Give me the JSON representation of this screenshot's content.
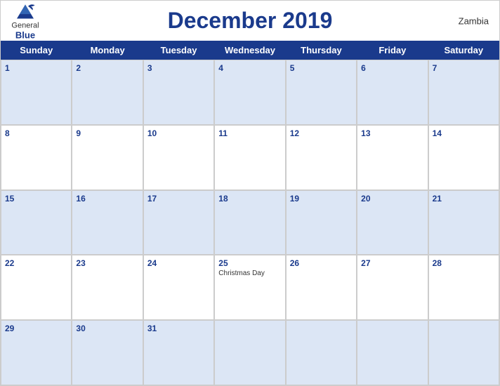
{
  "header": {
    "title": "December 2019",
    "country": "Zambia",
    "logo": {
      "general": "General",
      "blue": "Blue"
    }
  },
  "days": [
    "Sunday",
    "Monday",
    "Tuesday",
    "Wednesday",
    "Thursday",
    "Friday",
    "Saturday"
  ],
  "weeks": [
    [
      {
        "date": "1",
        "blue": true,
        "event": ""
      },
      {
        "date": "2",
        "blue": true,
        "event": ""
      },
      {
        "date": "3",
        "blue": true,
        "event": ""
      },
      {
        "date": "4",
        "blue": true,
        "event": ""
      },
      {
        "date": "5",
        "blue": true,
        "event": ""
      },
      {
        "date": "6",
        "blue": true,
        "event": ""
      },
      {
        "date": "7",
        "blue": true,
        "event": ""
      }
    ],
    [
      {
        "date": "8",
        "blue": false,
        "event": ""
      },
      {
        "date": "9",
        "blue": false,
        "event": ""
      },
      {
        "date": "10",
        "blue": false,
        "event": ""
      },
      {
        "date": "11",
        "blue": false,
        "event": ""
      },
      {
        "date": "12",
        "blue": false,
        "event": ""
      },
      {
        "date": "13",
        "blue": false,
        "event": ""
      },
      {
        "date": "14",
        "blue": false,
        "event": ""
      }
    ],
    [
      {
        "date": "15",
        "blue": true,
        "event": ""
      },
      {
        "date": "16",
        "blue": true,
        "event": ""
      },
      {
        "date": "17",
        "blue": true,
        "event": ""
      },
      {
        "date": "18",
        "blue": true,
        "event": ""
      },
      {
        "date": "19",
        "blue": true,
        "event": ""
      },
      {
        "date": "20",
        "blue": true,
        "event": ""
      },
      {
        "date": "21",
        "blue": true,
        "event": ""
      }
    ],
    [
      {
        "date": "22",
        "blue": false,
        "event": ""
      },
      {
        "date": "23",
        "blue": false,
        "event": ""
      },
      {
        "date": "24",
        "blue": false,
        "event": ""
      },
      {
        "date": "25",
        "blue": false,
        "event": "Christmas Day"
      },
      {
        "date": "26",
        "blue": false,
        "event": ""
      },
      {
        "date": "27",
        "blue": false,
        "event": ""
      },
      {
        "date": "28",
        "blue": false,
        "event": ""
      }
    ],
    [
      {
        "date": "29",
        "blue": true,
        "event": ""
      },
      {
        "date": "30",
        "blue": true,
        "event": ""
      },
      {
        "date": "31",
        "blue": true,
        "event": ""
      },
      {
        "date": "",
        "blue": true,
        "event": ""
      },
      {
        "date": "",
        "blue": true,
        "event": ""
      },
      {
        "date": "",
        "blue": true,
        "event": ""
      },
      {
        "date": "",
        "blue": true,
        "event": ""
      }
    ]
  ]
}
